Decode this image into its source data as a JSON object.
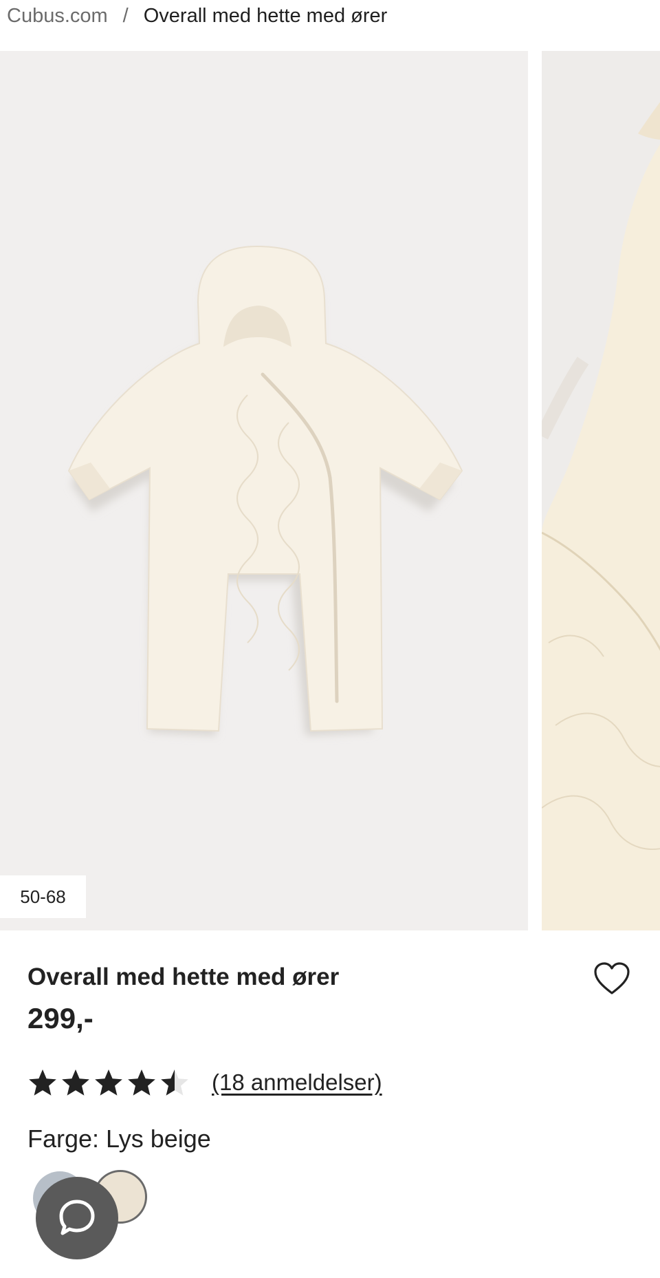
{
  "breadcrumb": {
    "home": "Cubus.com",
    "separator": "/",
    "current": "Overall med hette med ører"
  },
  "gallery": {
    "size_badge": "50-68"
  },
  "product": {
    "title": "Overall med hette med ører",
    "price": "299,-",
    "rating_value": 4.5,
    "rating_max": 5,
    "reviews_label": "(18 anmeldelser)",
    "color_label": "Farge: Lys beige"
  },
  "swatches": [
    {
      "name": "blue-grey",
      "color": "#b7bfc8"
    },
    {
      "name": "light-beige",
      "color": "#ece3d3",
      "selected": true
    }
  ],
  "icons": {
    "wishlist": "heart-outline-icon",
    "chat": "chat-bubble-icon",
    "star": "star-icon"
  },
  "colors": {
    "text": "#1f1f1f",
    "muted": "#6b6b6b",
    "image_bg": "#f1efee",
    "chat_bg": "#5a5a5a"
  }
}
